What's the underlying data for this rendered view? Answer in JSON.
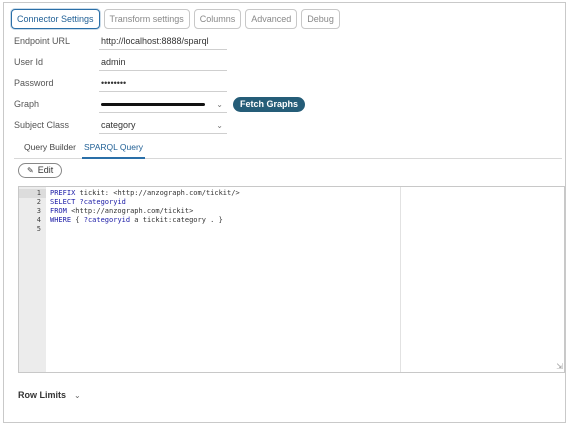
{
  "top_tabs": [
    {
      "label": "Connector Settings",
      "active": true
    },
    {
      "label": "Transform settings",
      "active": false
    },
    {
      "label": "Columns",
      "active": false
    },
    {
      "label": "Advanced",
      "active": false
    },
    {
      "label": "Debug",
      "active": false
    }
  ],
  "form": {
    "endpoint_url": {
      "label": "Endpoint URL",
      "value": "http://localhost:8888/sparql"
    },
    "user_id": {
      "label": "User Id",
      "value": "admin"
    },
    "password": {
      "label": "Password",
      "value": "••••••••"
    },
    "graph": {
      "label": "Graph",
      "fetch_button": "Fetch Graphs"
    },
    "subject_class": {
      "label": "Subject Class",
      "value": "category"
    }
  },
  "sub_tabs": [
    {
      "label": "Query Builder",
      "active": false
    },
    {
      "label": "SPARQL Query",
      "active": true
    }
  ],
  "edit_button": "Edit",
  "editor": {
    "line_numbers": [
      "1",
      "2",
      "3",
      "4",
      "5"
    ],
    "lines": [
      "PREFIX tickit: <http://anzograph.com/tickit/>",
      "SELECT ?categoryid",
      "FROM <http://anzograph.com/tickit>",
      "WHERE { ?categoryid a tickit:category . }",
      ""
    ]
  },
  "row_limits": "Row Limits",
  "icons": {
    "dropdown": "chevron-down-icon",
    "edit": "pencil-icon",
    "resize": "resize-handle-icon"
  }
}
